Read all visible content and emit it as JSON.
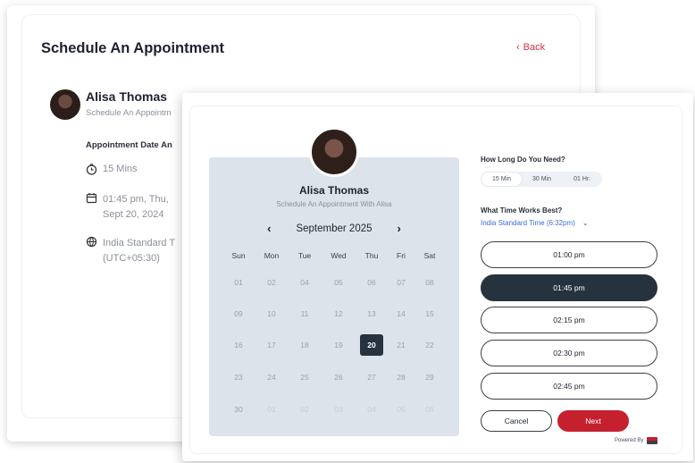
{
  "back": {
    "title": "Schedule An Appointment",
    "back_link": "Back",
    "name": "Alisa Thomas",
    "subtitle": "Schedule An Appointm",
    "label": "Appointment Date An",
    "duration": "15 Mins",
    "datetime_line1": "01:45 pm, Thu,",
    "datetime_line2": "Sept 20, 2024",
    "timezone_line1": "India Standard T",
    "timezone_line2": "(UTC+05:30)",
    "icons": {
      "duration": "clock-icon",
      "date": "calendar-icon",
      "timezone": "globe-icon",
      "back": "chevron-left-icon"
    }
  },
  "profile": {
    "name": "Alisa Thomas",
    "subtitle": "Schedule An Appointment With Alisa"
  },
  "calendar": {
    "month": "September 2025",
    "prev": "‹",
    "next": "›",
    "weekdays": [
      "Sun",
      "Mon",
      "Tue",
      "Wed",
      "Thu",
      "Fri",
      "Sat"
    ],
    "weeks": [
      [
        "01",
        "02",
        "04",
        "05",
        "06",
        "07",
        "08"
      ],
      [
        "09",
        "10",
        "11",
        "12",
        "13",
        "14",
        "15"
      ],
      [
        "16",
        "17",
        "18",
        "19",
        "20",
        "21",
        "22"
      ],
      [
        "23",
        "24",
        "25",
        "26",
        "27",
        "28",
        "29"
      ],
      [
        "30",
        "01",
        "02",
        "03",
        "04",
        "05",
        "06"
      ]
    ],
    "selected": "20"
  },
  "duration": {
    "label": "How Long Do You Need?",
    "options": [
      "15 Min",
      "30 Min",
      "01 Hr."
    ],
    "selected": "15 Min"
  },
  "time": {
    "label": "What Time Works Best?",
    "timezone": "India Standard Time (6:32pm)",
    "slots": [
      "01:00 pm",
      "01:45 pm",
      "02:15 pm",
      "02:30 pm",
      "02:45 pm"
    ],
    "selected": "01:45 pm"
  },
  "actions": {
    "cancel": "Cancel",
    "next": "Next"
  },
  "footer": {
    "powered_by": "Powered By"
  },
  "colors": {
    "accent": "#c5202e",
    "dark": "#27323f",
    "link": "#3b6fd1",
    "panel": "#dde3ea"
  }
}
